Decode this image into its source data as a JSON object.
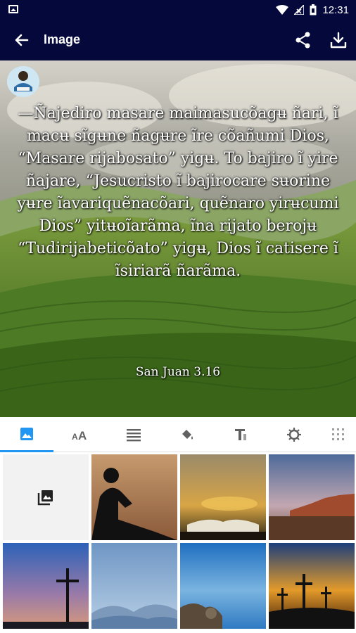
{
  "status_bar": {
    "time": "12:31",
    "icons": [
      "image-icon",
      "wifi-icon",
      "signal-icon",
      "battery-icon"
    ]
  },
  "app_bar": {
    "title": "Image",
    "icons": [
      "back-arrow-icon",
      "share-icon",
      "download-icon"
    ]
  },
  "preview": {
    "verse": "—Ñajediro masare maimasucõagʉ ñari, ĩ macʉ sĩgʉne ñagʉre ĩre cõañumi Dios, “Masare rijabosato” yigʉ. To bajiro ĩ yire ñajare, “Jesucristo ĩ bajirocare sʉorine yʉre ĩavariquẽnacõari, quẽnaro yirʉcumi Dios” yitʉoĩarãma, ĩna rijato berojʉ “Tudirijabeticõato” yigʉ, Dios ĩ catisere ĩ ĩsiriarã ñarãma.",
    "reference": "San Juan 3.16"
  },
  "tabs": [
    {
      "icon": "image-icon",
      "active": true
    },
    {
      "icon": "text-size-icon",
      "active": false
    },
    {
      "icon": "align-icon",
      "active": false
    },
    {
      "icon": "paint-bucket-icon",
      "active": false
    },
    {
      "icon": "text-format-icon",
      "active": false
    },
    {
      "icon": "brightness-icon",
      "active": false
    },
    {
      "icon": "grid-icon",
      "active": false
    }
  ],
  "backgrounds": [
    "gallery-picker",
    "child-reading-silhouette",
    "open-bible-sunset",
    "desert-cliffs",
    "cross-silhouette-dusk",
    "misty-mountains",
    "rocky-coast",
    "three-crosses-sunset"
  ],
  "colors": {
    "app_bar": "#04083a",
    "accent": "#2196f3",
    "text_on_image": "#ffffff"
  }
}
